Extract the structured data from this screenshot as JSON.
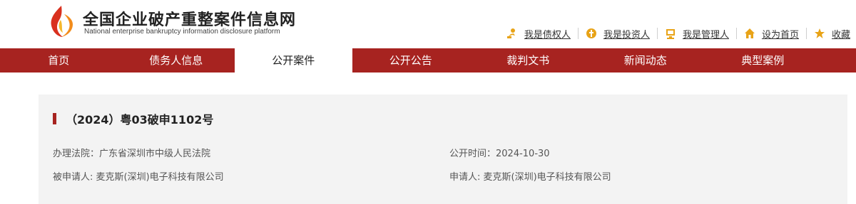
{
  "header": {
    "title": "全国企业破产重整案件信息网",
    "subtitle": "National enterprise bankruptcy information disclosure platform",
    "links": [
      {
        "label": "我是债权人",
        "icon": "creditor-icon"
      },
      {
        "label": "我是投资人",
        "icon": "investor-icon"
      },
      {
        "label": "我是管理人",
        "icon": "administrator-icon"
      },
      {
        "label": "设为首页",
        "icon": "home-icon"
      },
      {
        "label": "收藏",
        "icon": "star-icon"
      }
    ]
  },
  "nav": {
    "items": [
      "首页",
      "债务人信息",
      "公开案件",
      "公开公告",
      "裁判文书",
      "新闻动态",
      "典型案例"
    ],
    "active": "公开案件"
  },
  "case": {
    "number": "（2024）粤03破申1102号",
    "court_label": "办理法院：",
    "court": "广东省深圳市中级人民法院",
    "time_label": "公开时间：",
    "time": "2024-10-30",
    "respondent_label": "被申请人: ",
    "respondent": "麦克斯(深圳)电子科技有限公司",
    "applicant_label": "申请人: ",
    "applicant": "麦克斯(深圳)电子科技有限公司"
  },
  "colors": {
    "accent": "#a72320",
    "icon_orange": "#e8a317"
  }
}
